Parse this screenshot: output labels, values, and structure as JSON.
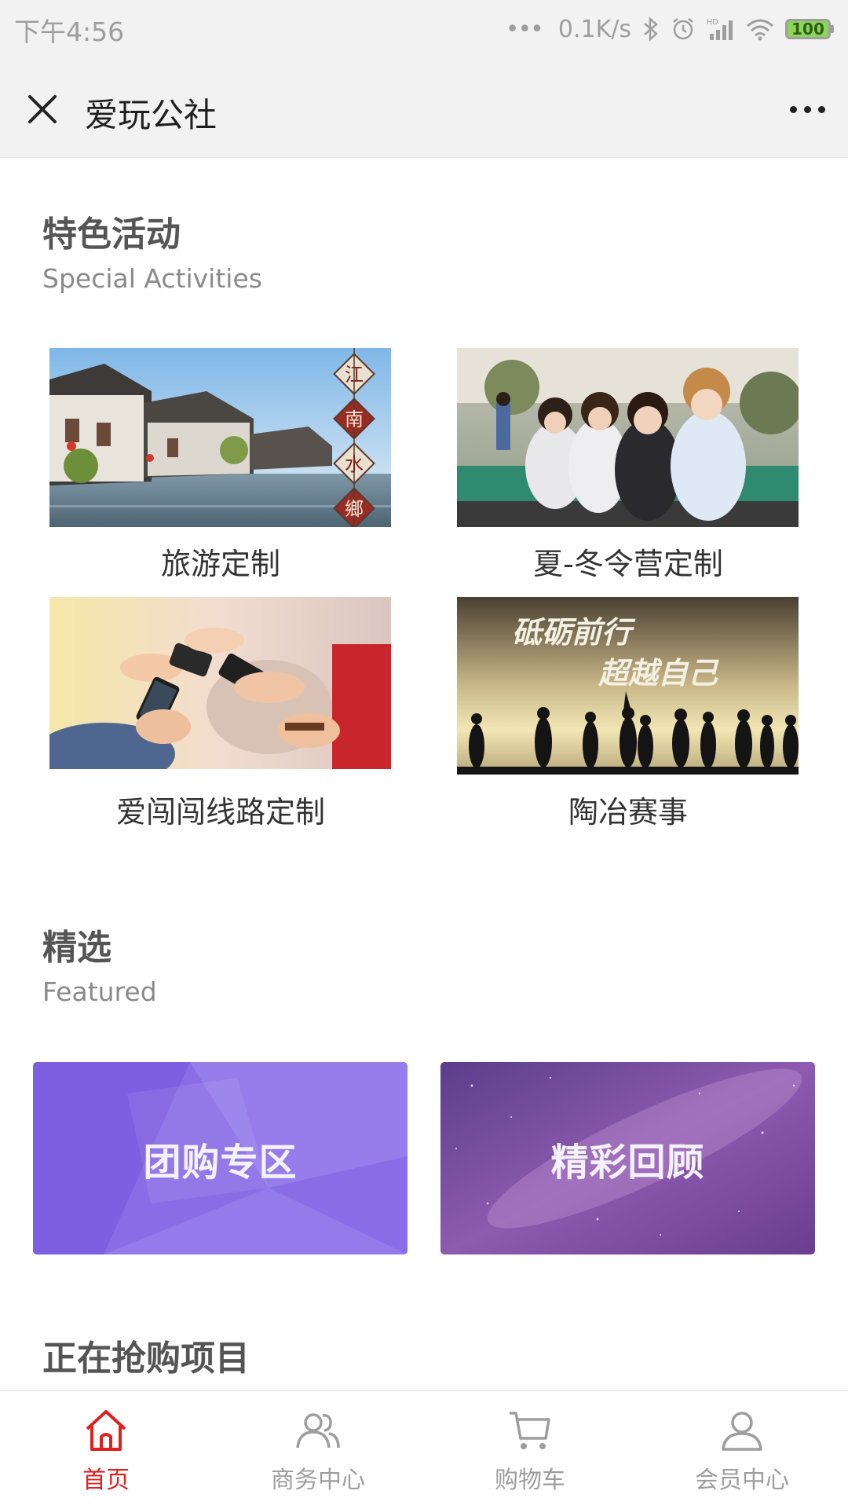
{
  "status_bar": {
    "time": "下午4:56",
    "dots": "•••",
    "net_speed": "0.1K/s",
    "battery": "100"
  },
  "nav": {
    "title": "爱玩公社",
    "close_icon": "close-icon",
    "more_icon": "more-dots-icon"
  },
  "special": {
    "title": "特色活动",
    "subtitle": "Special Activities",
    "items": [
      {
        "label": "旅游定制"
      },
      {
        "label": "夏-冬令营定制"
      },
      {
        "label": "爱闯闯线路定制"
      },
      {
        "label": "陶冶赛事",
        "image_text": [
          "砥砺前行",
          "超越自己"
        ]
      }
    ],
    "banner_chars": [
      "江",
      "南",
      "水",
      "鄉"
    ]
  },
  "featured": {
    "title": "精选",
    "subtitle": "Featured",
    "cards": [
      {
        "label": "团购专区",
        "color": "#8a6de6"
      },
      {
        "label": "精彩回顾",
        "color": "#7d4aa8"
      }
    ]
  },
  "flash": {
    "title": "正在抢购项目"
  },
  "tabbar": {
    "active_color": "#e01f1f",
    "inactive_color": "#9e9e9e",
    "items": [
      {
        "label": "首页",
        "icon": "home-icon",
        "active": true
      },
      {
        "label": "商务中心",
        "icon": "users-icon",
        "active": false
      },
      {
        "label": "购物车",
        "icon": "cart-icon",
        "active": false
      },
      {
        "label": "会员中心",
        "icon": "user-icon",
        "active": false
      }
    ]
  }
}
